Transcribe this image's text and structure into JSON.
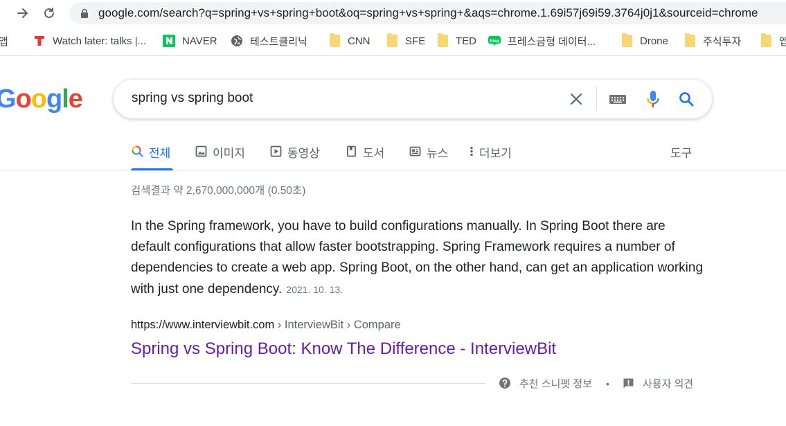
{
  "browser": {
    "url": "google.com/search?q=spring+vs+spring+boot&oq=spring+vs+spring+&aqs=chrome.1.69i57j69i59.3764j0j1&sourceid=chrome",
    "bookmarks": [
      {
        "label": "앱",
        "icon": "apps-grid-icon"
      },
      {
        "label": "Watch later: talks |...",
        "icon": "red-t-icon"
      },
      {
        "label": "NAVER",
        "icon": "naver-icon"
      },
      {
        "label": "테스트클리닉",
        "icon": "globe-icon"
      },
      {
        "label": "CNN",
        "icon": "folder-icon"
      },
      {
        "label": "SFE",
        "icon": "folder-icon"
      },
      {
        "label": "TED",
        "icon": "folder-icon"
      },
      {
        "label": "프레스금형 데이터...",
        "icon": "blog-icon"
      },
      {
        "label": "Drone",
        "icon": "folder-icon"
      },
      {
        "label": "주식투자",
        "icon": "folder-icon"
      },
      {
        "label": "앱",
        "icon": "folder-icon"
      }
    ]
  },
  "search": {
    "query": "spring vs spring boot",
    "logo_letters": [
      "G",
      "o",
      "o",
      "g",
      "l",
      "e"
    ],
    "logo_colors": [
      "#4285f4",
      "#ea4335",
      "#fbbc05",
      "#4285f4",
      "#34a853",
      "#ea4335"
    ]
  },
  "tabs": [
    {
      "label": "전체",
      "icon": "search-icon",
      "active": true
    },
    {
      "label": "이미지",
      "icon": "image-icon"
    },
    {
      "label": "동영상",
      "icon": "video-icon"
    },
    {
      "label": "도서",
      "icon": "book-icon"
    },
    {
      "label": "뉴스",
      "icon": "news-icon"
    },
    {
      "label": "더보기",
      "icon": "more-vert-icon"
    }
  ],
  "tools_label": "도구",
  "stats": "검색결과 약 2,670,000,000개 (0.50초)",
  "snippet": {
    "text": "In the Spring framework, you have to build configurations manually. In Spring Boot there are default configurations that allow faster bootstrapping. Spring Framework requires a number of dependencies to create a web app. Spring Boot, on the other hand, can get an application working with just one dependency.",
    "date": "2021. 10. 13."
  },
  "result": {
    "cite_domain": "https://www.interviewbit.com",
    "cite_path": " › InterviewBit › Compare",
    "title": "Spring vs Spring Boot: Know The Difference - InterviewBit"
  },
  "feedback": {
    "about_snippet": "추천 스니펫 정보",
    "separator": "•",
    "user_feedback": "사용자 의견"
  },
  "colors": {
    "accent": "#1a73e8",
    "visited_link": "#681da8",
    "mic_blue": "#4285f4",
    "mic_red": "#ea4335"
  }
}
